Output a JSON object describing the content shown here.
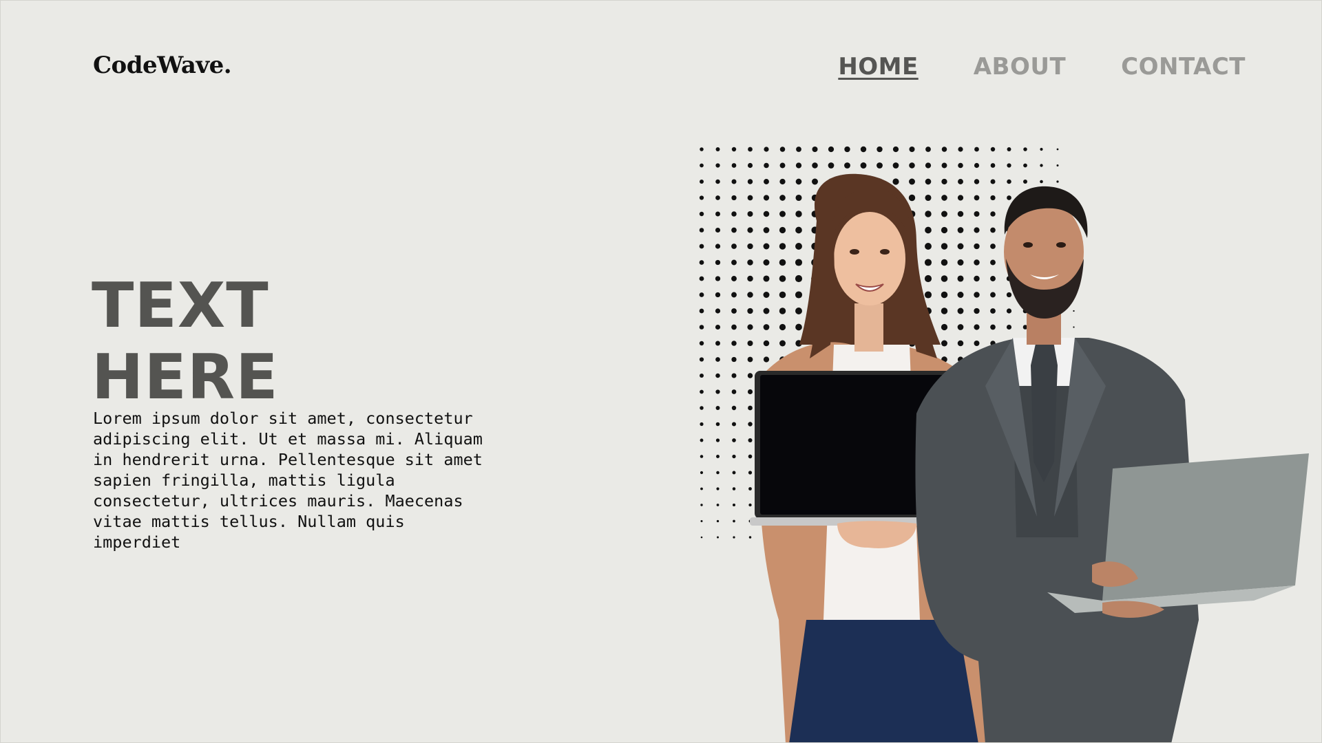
{
  "header": {
    "logo": "CodeWave.",
    "nav": [
      {
        "label": "HOME",
        "active": true
      },
      {
        "label": "ABOUT",
        "active": false
      },
      {
        "label": "CONTACT",
        "active": false
      }
    ]
  },
  "hero": {
    "title_line1": "TEXT",
    "title_line2": "HERE",
    "body": "Lorem ipsum dolor sit amet, consectetur adipiscing elit. Ut et massa mi. Aliquam in hendrerit urna. Pellentesque sit amet sapien fringilla, mattis ligula consectetur, ultrices mauris. Maecenas vitae mattis tellus. Nullam quis imperdiet"
  },
  "colors": {
    "background": "#eaeae6",
    "title": "#545451",
    "nav_active": "#555553",
    "nav_inactive": "#9a9a97"
  }
}
